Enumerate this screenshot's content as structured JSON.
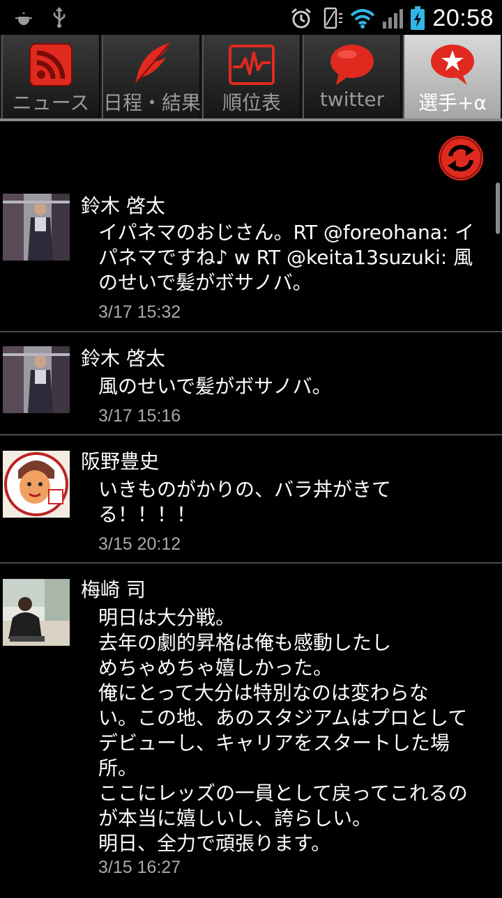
{
  "status_bar": {
    "time": "20:58",
    "icons": [
      "android-debug-icon",
      "usb-icon",
      "alarm-icon",
      "vibrate-icon",
      "wifi-icon",
      "signal-icon",
      "battery-charging-icon"
    ]
  },
  "tabs": [
    {
      "label": "ニュース",
      "icon": "rss-icon"
    },
    {
      "label": "日程・結果",
      "icon": "feather-icon"
    },
    {
      "label": "順位表",
      "icon": "pulse-chart-icon"
    },
    {
      "label": "twitter",
      "icon": "speech-bubble-icon"
    },
    {
      "label": "選手+α",
      "icon": "star-bubble-icon",
      "active": true
    }
  ],
  "tweets": [
    {
      "author": "鈴木 啓太",
      "text": "イパネマのおじさん。RT @foreohana: イ\nパネマですね♪ w RT @keita13suzuki: 風\nのせいで髪がボサノバ。",
      "time": "3/17 15:32"
    },
    {
      "author": "鈴木 啓太",
      "text": "風のせいで髪がボサノバ。",
      "time": "3/17 15:16"
    },
    {
      "author": "阪野豊史",
      "text": "いきものがかりの、バラ丼がきて\nる！！！！",
      "time": "3/15 20:12"
    },
    {
      "author": "梅崎 司",
      "text": "明日は大分戦。\n去年の劇的昇格は俺も感動したし\nめちゃめちゃ嬉しかった。\n俺にとって大分は特別なのは変わらな\nい。この地、あのスタジアムはプロとして\nデビューし、キャリアをスタートした場\n所。\nここにレッズの一員として戻ってこれるの\nが本当に嬉しいし、誇らしい。\n明日、全力で頑張ります。",
      "time": "3/15 16:27"
    }
  ],
  "colors": {
    "accent_red": "#e02a1f",
    "tab_active_bg": "#c4c4c4",
    "timestamp": "#aaaaaa",
    "divider": "#4a4a4a"
  }
}
